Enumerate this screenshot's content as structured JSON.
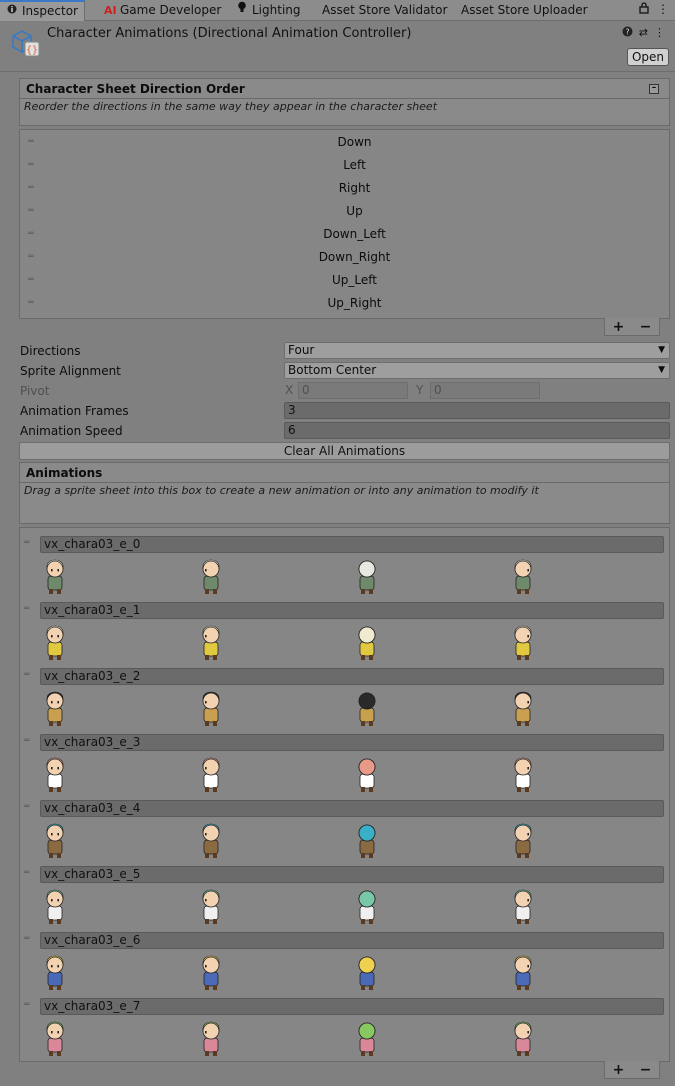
{
  "tabs": [
    {
      "label": "Inspector",
      "icon": "info-icon"
    },
    {
      "label": "Game Developer",
      "icon": "ai-icon"
    },
    {
      "label": "Lighting",
      "icon": "bulb-icon"
    },
    {
      "label": "Asset Store Validator",
      "icon": ""
    },
    {
      "label": "Asset Store Uploader",
      "icon": ""
    }
  ],
  "header": {
    "title": "Character Animations (Directional Animation Controller)",
    "open_label": "Open"
  },
  "direction_order": {
    "title": "Character Sheet Direction Order",
    "description": "Reorder the directions in the same way they appear in the character sheet",
    "items": [
      "Down",
      "Left",
      "Right",
      "Up",
      "Down_Left",
      "Down_Right",
      "Up_Left",
      "Up_Right"
    ]
  },
  "controls": {
    "plus": "+",
    "minus": "−"
  },
  "properties": {
    "directions": {
      "label": "Directions",
      "value": "Four"
    },
    "sprite_alignment": {
      "label": "Sprite Alignment",
      "value": "Bottom Center"
    },
    "pivot": {
      "label": "Pivot",
      "x_label": "X",
      "x_value": "0",
      "y_label": "Y",
      "y_value": "0"
    },
    "animation_frames": {
      "label": "Animation Frames",
      "value": "3"
    },
    "animation_speed": {
      "label": "Animation Speed",
      "value": "6"
    }
  },
  "clear_all_label": "Clear All Animations",
  "animations_section": {
    "title": "Animations",
    "description": "Drag a sprite sheet into this box to create a new animation or into any animation to modify it"
  },
  "animations": [
    {
      "name": "vx_chara03_e_0",
      "hair": "#e8e8e0",
      "body": "#6e8a6a",
      "skin": "#f2d2b0"
    },
    {
      "name": "vx_chara03_e_1",
      "hair": "#f0ead0",
      "body": "#e0c840",
      "skin": "#f2d2b0"
    },
    {
      "name": "vx_chara03_e_2",
      "hair": "#2a2a2a",
      "body": "#c8a050",
      "skin": "#f2d2b0"
    },
    {
      "name": "vx_chara03_e_3",
      "hair": "#e89a88",
      "body": "#ffffff",
      "skin": "#f2d2b0"
    },
    {
      "name": "vx_chara03_e_4",
      "hair": "#3ab0c8",
      "body": "#8a6a40",
      "skin": "#f2d2b0"
    },
    {
      "name": "vx_chara03_e_5",
      "hair": "#78c8a8",
      "body": "#f0f0f0",
      "skin": "#f2d2b0"
    },
    {
      "name": "vx_chara03_e_6",
      "hair": "#f0d050",
      "body": "#4a6ab8",
      "skin": "#f2d2b0"
    },
    {
      "name": "vx_chara03_e_7",
      "hair": "#88c860",
      "body": "#d88898",
      "skin": "#f2d2b0"
    }
  ]
}
